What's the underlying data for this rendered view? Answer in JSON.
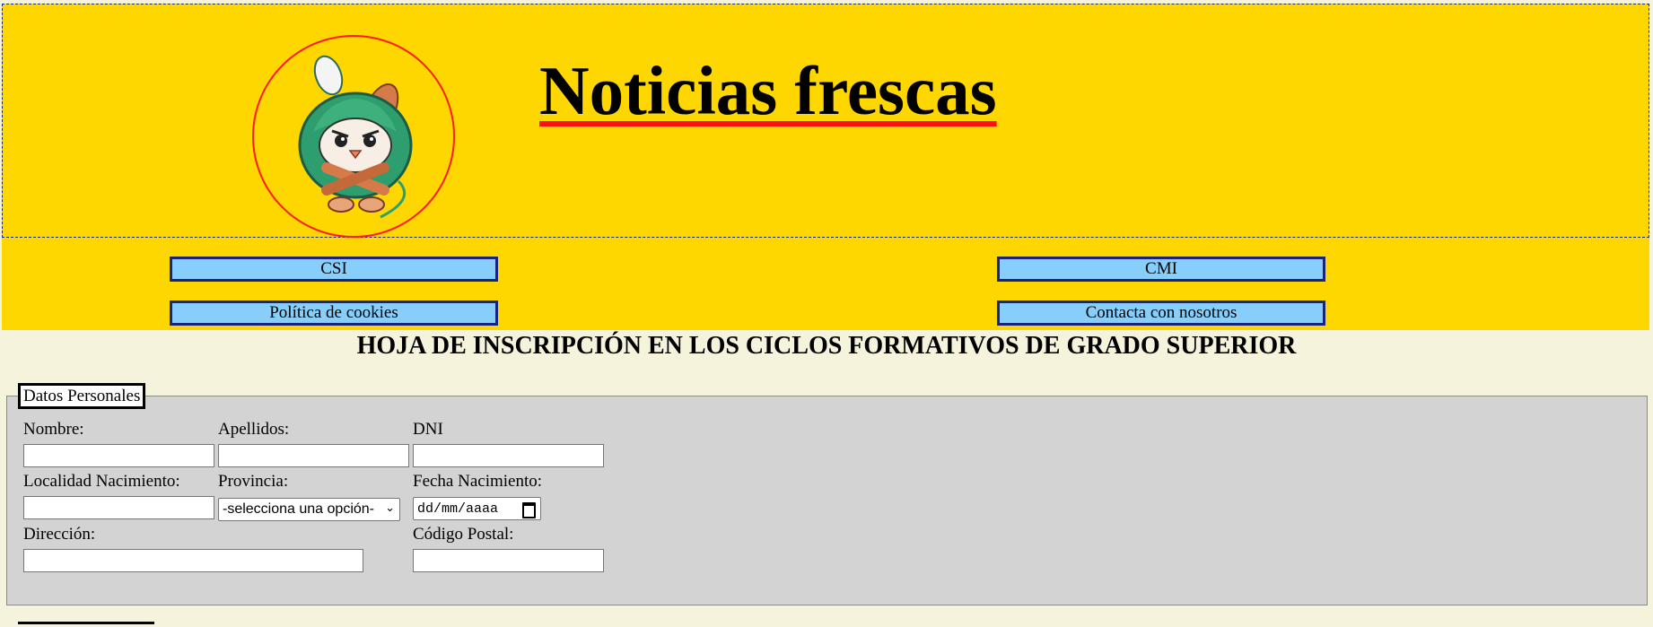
{
  "header": {
    "title": "Noticias frescas",
    "logo_icon": "mascot-icon"
  },
  "nav": {
    "items": [
      {
        "label": "CSI"
      },
      {
        "label": "CMI"
      },
      {
        "label": "Política de cookies"
      },
      {
        "label": "Contacta con nosotros"
      }
    ]
  },
  "form": {
    "title": "HOJA DE INSCRIPCIÓN EN LOS CICLOS FORMATIVOS DE GRADO SUPERIOR",
    "legend": "Datos Personales",
    "fields": {
      "nombre": {
        "label": "Nombre:",
        "value": ""
      },
      "apellidos": {
        "label": "Apellidos:",
        "value": ""
      },
      "dni": {
        "label": "DNI",
        "value": ""
      },
      "localidad": {
        "label": "Localidad Nacimiento:",
        "value": ""
      },
      "provincia": {
        "label": "Provincia:",
        "selected": "-selecciona una opción-"
      },
      "fecha": {
        "label": "Fecha Nacimiento:",
        "placeholder": "dd/mm/aaaa"
      },
      "direccion": {
        "label": "Dirección:",
        "value": ""
      },
      "codigo_postal": {
        "label": "Código Postal:",
        "value": ""
      }
    }
  },
  "colors": {
    "header_bg": "#ffd700",
    "nav_button_bg": "#87cefa",
    "title_underline": "#ff1010",
    "page_bg": "#f5f3dc",
    "fieldset_bg": "#d3d3d3"
  }
}
